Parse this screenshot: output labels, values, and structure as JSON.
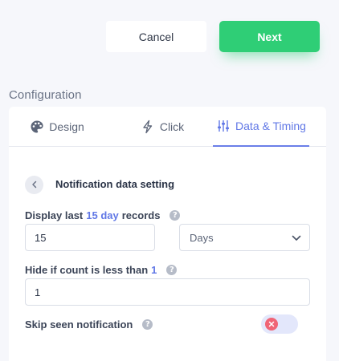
{
  "header": {
    "cancel_label": "Cancel",
    "next_label": "Next"
  },
  "section": {
    "title": "Configuration"
  },
  "tabs": [
    {
      "label": "Design",
      "icon": "palette-icon",
      "active": false
    },
    {
      "label": "Click",
      "icon": "lightning-icon",
      "active": false
    },
    {
      "label": "Data & Timing",
      "icon": "sliders-icon",
      "active": true
    }
  ],
  "panel": {
    "title": "Notification data setting",
    "display_last": {
      "prefix": "Display last",
      "highlight": "15 day",
      "suffix": "records",
      "value": "15",
      "unit": "Days"
    },
    "hide_count": {
      "prefix": "Hide if count is less than",
      "highlight": "1",
      "value": "1"
    },
    "skip_seen": {
      "label": "Skip seen notification",
      "enabled": false
    }
  },
  "colors": {
    "primary": "#2fce76",
    "accent": "#6178e6",
    "toggle_off": "#f06576"
  }
}
